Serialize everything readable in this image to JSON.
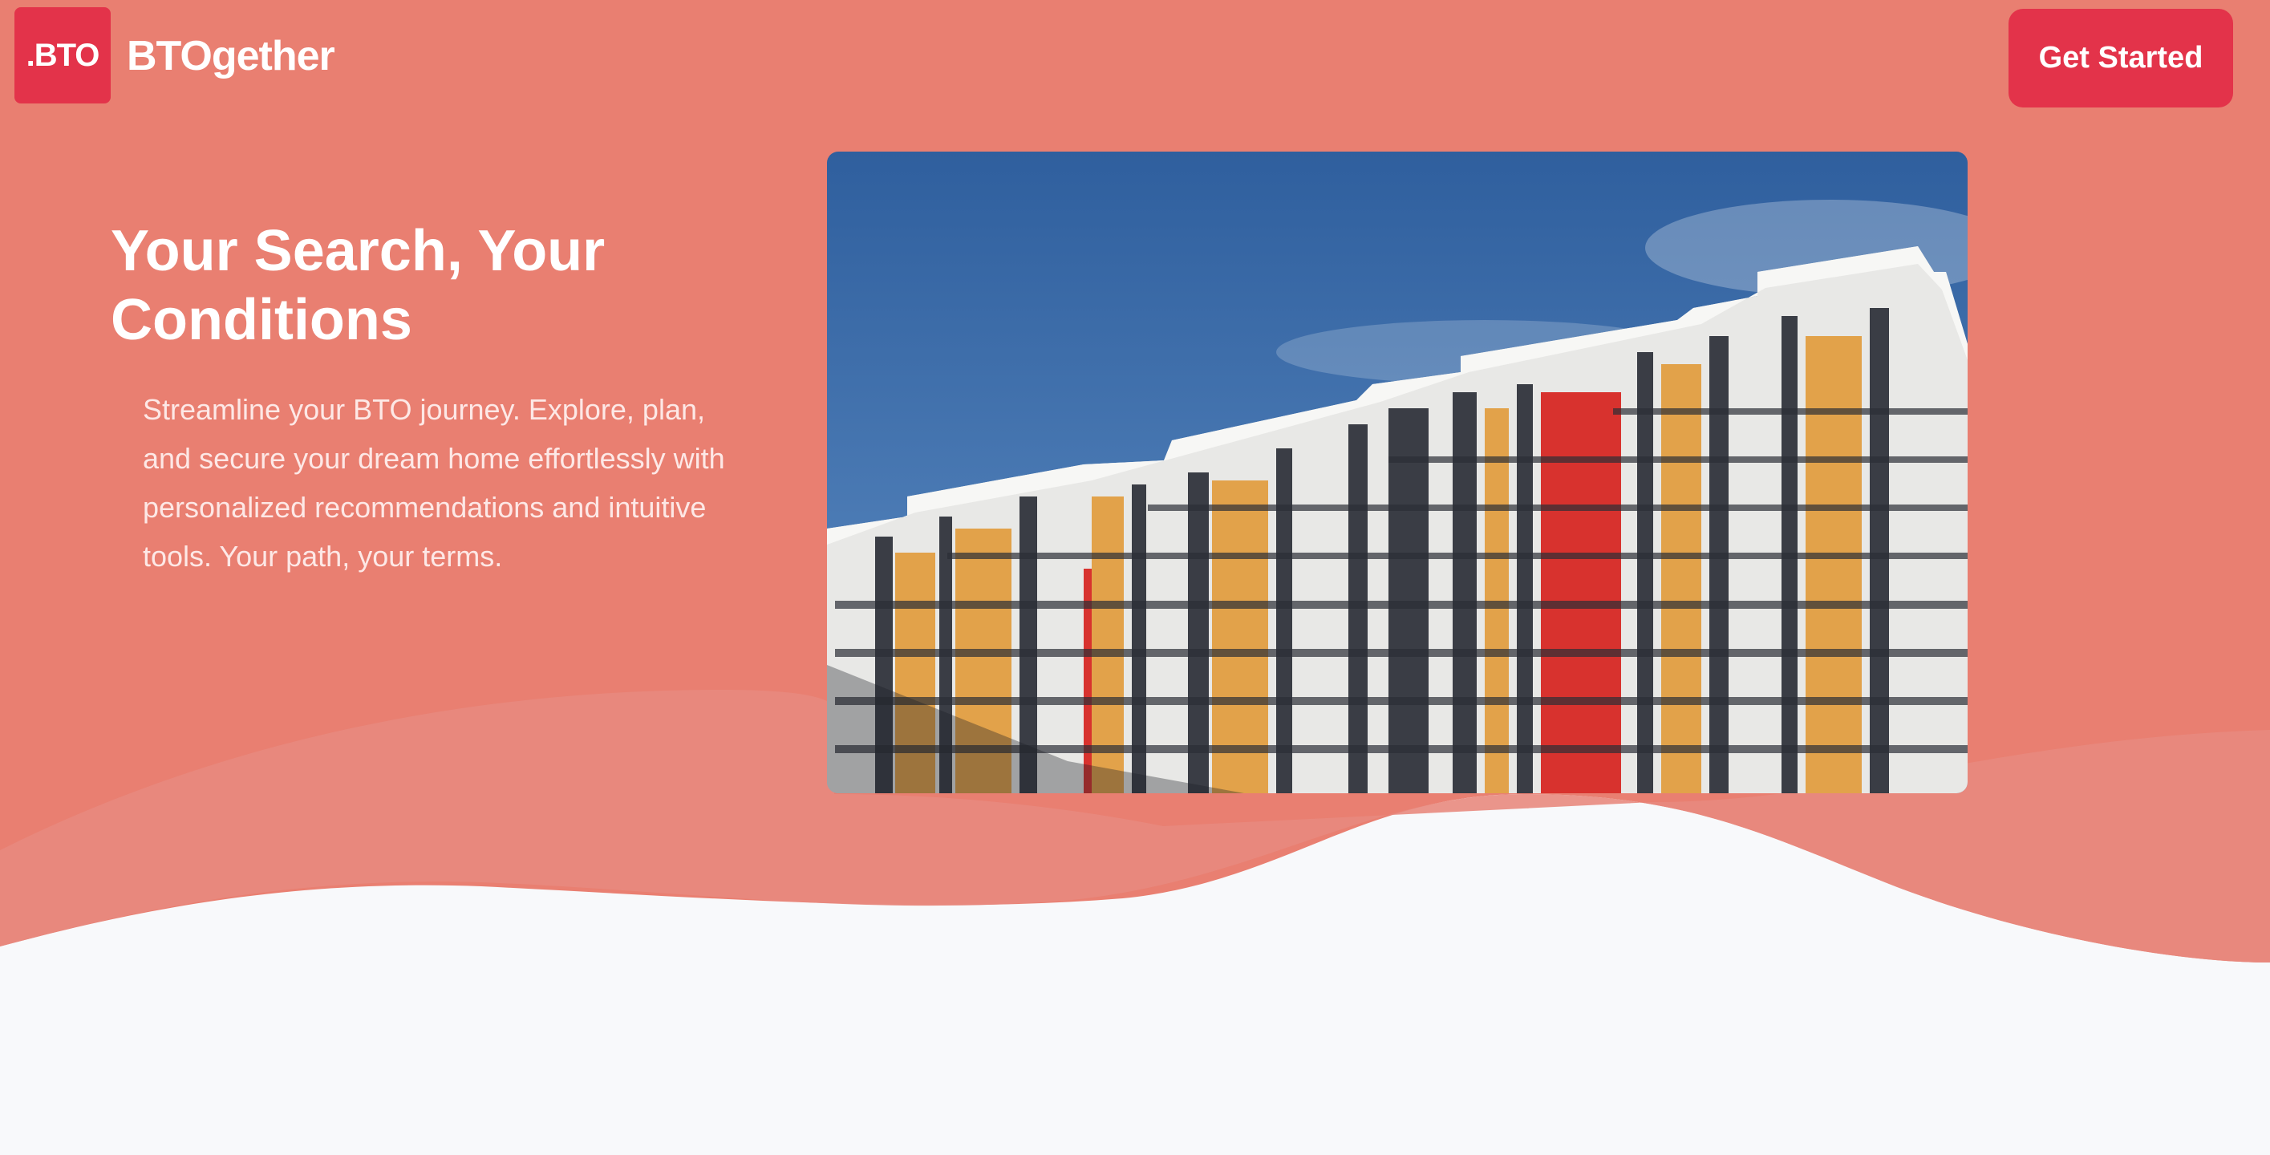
{
  "header": {
    "logo_text": ".BTO",
    "brand_name": "BTOgether",
    "cta_label": "Get Started"
  },
  "hero": {
    "headline": "Your Search, Your Conditions",
    "description": "Streamline your BTO journey. Explore, plan, and secure your dream home effortlessly with personalized recommendations and intuitive tools. Your path, your terms.",
    "image_subject": "public-housing-apartment-block"
  },
  "colors": {
    "hero_background": "#e97f71",
    "wave_light": "#e8897e",
    "accent": "#e3334a",
    "page_background": "#f8f9fb"
  }
}
